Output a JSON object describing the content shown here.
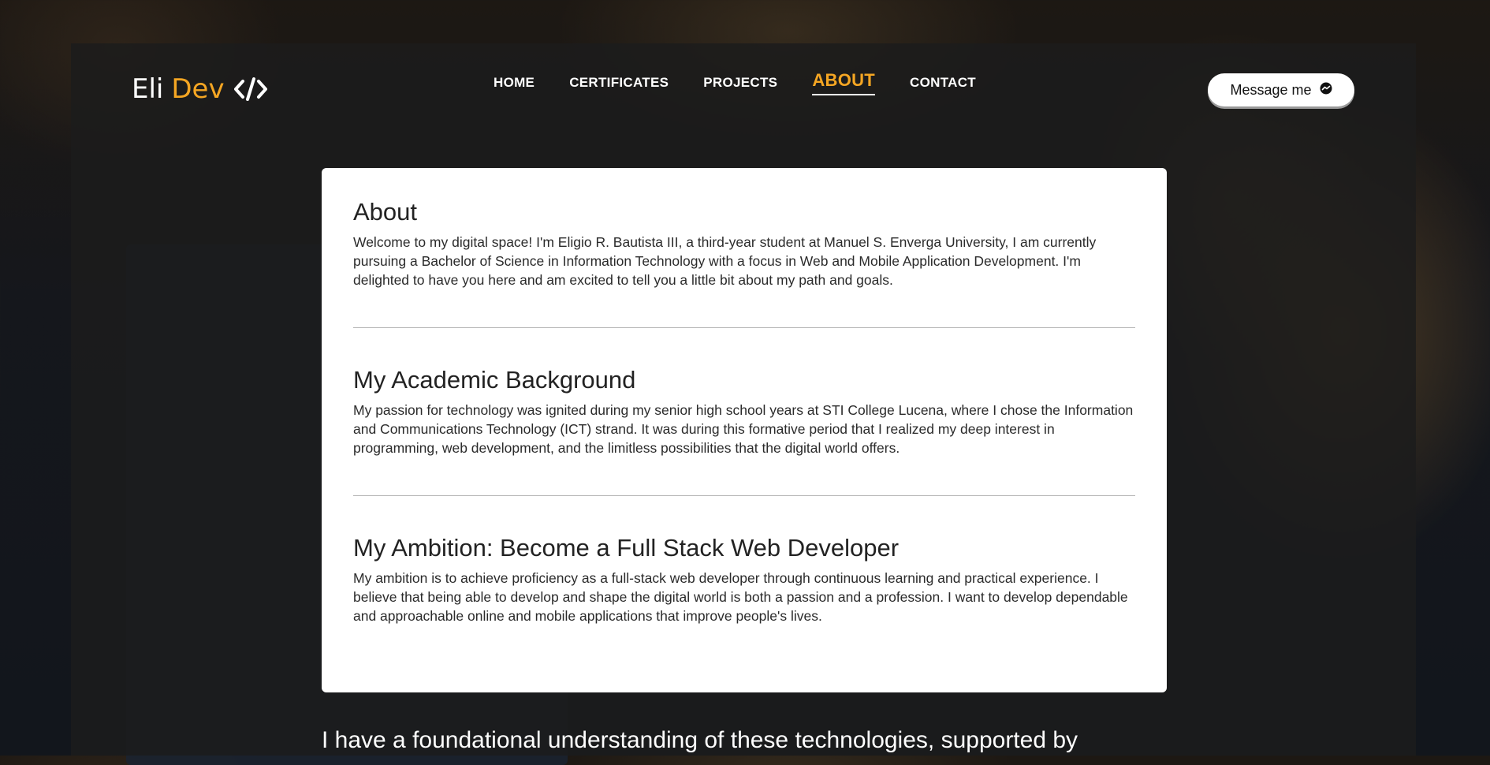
{
  "header": {
    "logo": {
      "first": "Eli",
      "second": "Dev"
    },
    "nav": [
      {
        "label": "HOME"
      },
      {
        "label": "CERTIFICATES"
      },
      {
        "label": "PROJECTS"
      },
      {
        "label": "ABOUT",
        "active": true
      },
      {
        "label": "CONTACT"
      }
    ],
    "message_button": {
      "label": "Message me",
      "icon": "messenger-icon"
    }
  },
  "about": {
    "sections": [
      {
        "title": "About",
        "body": "Welcome to my digital space! I'm Eligio R. Bautista III, a third-year student at Manuel S. Enverga University, I am currently pursuing a Bachelor of Science in Information Technology with a focus in Web and Mobile Application Development. I'm delighted to have you here and am excited to tell you a little bit about my path and goals."
      },
      {
        "title": "My Academic Background",
        "body": "My passion for technology was ignited during my senior high school years at STI College Lucena, where I chose the Information and Communications Technology (ICT) strand. It was during this formative period that I realized my deep interest in programming, web development, and the limitless possibilities that the digital world offers."
      },
      {
        "title": "My Ambition: Become a Full Stack Web Developer",
        "body": "My ambition is to achieve proficiency as a full-stack web developer through continuous learning and practical experience. I believe that being able to develop and shape the digital world is both a passion and a profession. I want to develop dependable and approachable online and mobile applications that improve people's lives."
      }
    ]
  },
  "footer_heading": "I have a foundational understanding of these technologies, supported by",
  "colors": {
    "accent": "#f5a623",
    "overlay": "#1c1c1c",
    "card": "#ffffff"
  }
}
